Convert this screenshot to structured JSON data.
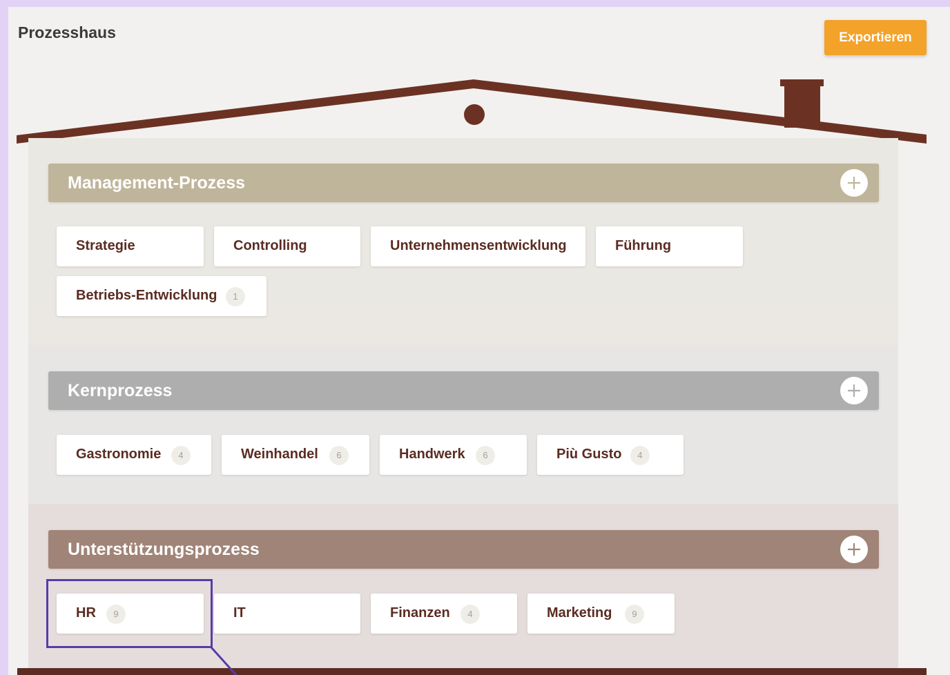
{
  "page": {
    "title": "Prozesshaus",
    "export_label": "Exportieren"
  },
  "colors": {
    "accent": "#f3a22a",
    "roof": "#6b3223",
    "management_header": "#bfb59a",
    "kern_header": "#aeaeae",
    "support_header": "#a08478",
    "chip_text": "#5a2c22",
    "highlight": "#5a3aa8"
  },
  "sections": [
    {
      "title": "Management-Prozess",
      "add_icon": "plus-icon",
      "items": [
        {
          "label": "Strategie",
          "count": ""
        },
        {
          "label": "Controlling",
          "count": ""
        },
        {
          "label": "Unternehmensentwicklung",
          "count": ""
        },
        {
          "label": "Führung",
          "count": ""
        },
        {
          "label": "Betriebs-Entwicklung",
          "count": "1"
        }
      ]
    },
    {
      "title": "Kernprozess",
      "add_icon": "plus-icon",
      "items": [
        {
          "label": "Gastronomie",
          "count": "4"
        },
        {
          "label": "Weinhandel",
          "count": "6"
        },
        {
          "label": "Handwerk",
          "count": "6"
        },
        {
          "label": "Più Gusto",
          "count": "4"
        }
      ]
    },
    {
      "title": "Unterstützungsprozess",
      "add_icon": "plus-icon",
      "items": [
        {
          "label": "HR",
          "count": "9"
        },
        {
          "label": "IT",
          "count": ""
        },
        {
          "label": "Finanzen",
          "count": "4"
        },
        {
          "label": "Marketing",
          "count": "9"
        }
      ]
    }
  ]
}
